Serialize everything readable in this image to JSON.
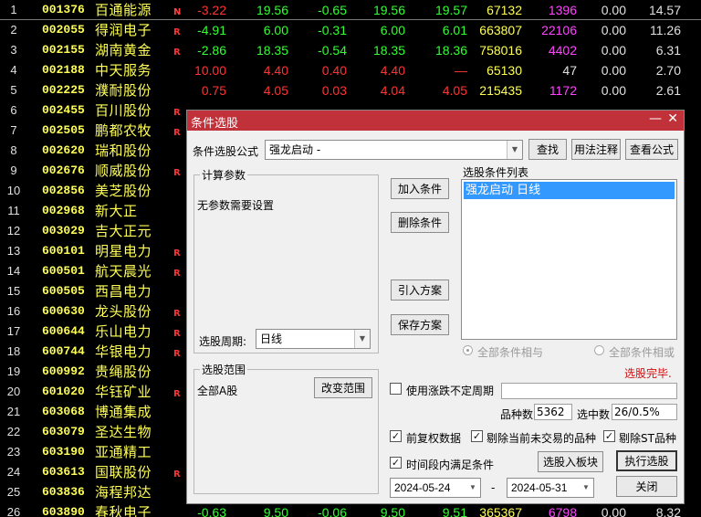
{
  "stocks": [
    {
      "idx": "1",
      "code": "001376",
      "name": "百通能源",
      "flag": "N",
      "chg": "-3.22",
      "price": "19.56",
      "amt": "-0.65",
      "open": "19.56",
      "high": "19.57",
      "vol": "67132",
      "cur": "1396",
      "x1": "0.00",
      "x2": "14.57",
      "c": [
        "r",
        "g",
        "g",
        "g",
        "g",
        "y",
        "m",
        "w",
        "w"
      ]
    },
    {
      "idx": "2",
      "code": "002055",
      "name": "得润电子",
      "flag": "R",
      "chg": "-4.91",
      "price": "6.00",
      "amt": "-0.31",
      "open": "6.00",
      "high": "6.01",
      "vol": "663807",
      "cur": "22106",
      "x1": "0.00",
      "x2": "11.26",
      "c": [
        "g",
        "g",
        "g",
        "g",
        "g",
        "y",
        "m",
        "w",
        "w"
      ]
    },
    {
      "idx": "3",
      "code": "002155",
      "name": "湖南黄金",
      "flag": "R",
      "chg": "-2.86",
      "price": "18.35",
      "amt": "-0.54",
      "open": "18.35",
      "high": "18.36",
      "vol": "758016",
      "cur": "4402",
      "x1": "0.00",
      "x2": "6.31",
      "c": [
        "g",
        "g",
        "g",
        "g",
        "g",
        "y",
        "m",
        "w",
        "w"
      ]
    },
    {
      "idx": "4",
      "code": "002188",
      "name": "中天服务",
      "flag": "",
      "chg": "10.00",
      "price": "4.40",
      "amt": "0.40",
      "open": "4.40",
      "high": "—",
      "vol": "65130",
      "cur": "47",
      "x1": "0.00",
      "x2": "2.70",
      "c": [
        "r",
        "r",
        "r",
        "r",
        "r",
        "y",
        "w",
        "w",
        "w"
      ]
    },
    {
      "idx": "5",
      "code": "002225",
      "name": "濮耐股份",
      "flag": "",
      "chg": "0.75",
      "price": "4.05",
      "amt": "0.03",
      "open": "4.04",
      "high": "4.05",
      "vol": "215435",
      "cur": "1172",
      "x1": "0.00",
      "x2": "2.61",
      "c": [
        "r",
        "r",
        "r",
        "r",
        "r",
        "y",
        "m",
        "w",
        "w"
      ]
    },
    {
      "idx": "6",
      "code": "002455",
      "name": "百川股份",
      "flag": "R",
      "chg": "",
      "price": "",
      "amt": "",
      "open": "",
      "high": "",
      "vol": "",
      "cur": "",
      "x1": "",
      "x2": "",
      "c": [
        "r",
        "r",
        "r",
        "r",
        "r",
        "y",
        "m",
        "w",
        "w"
      ]
    },
    {
      "idx": "7",
      "code": "002505",
      "name": "鹏都农牧",
      "flag": "R",
      "chg": "",
      "price": "",
      "amt": "",
      "open": "",
      "high": "",
      "vol": "",
      "cur": "",
      "x1": "",
      "x2": "",
      "c": [
        "r",
        "r",
        "r",
        "r",
        "r",
        "y",
        "m",
        "w",
        "w"
      ]
    },
    {
      "idx": "8",
      "code": "002620",
      "name": "瑞和股份",
      "flag": "",
      "chg": "",
      "price": "",
      "amt": "",
      "open": "",
      "high": "",
      "vol": "",
      "cur": "",
      "x1": "",
      "x2": "",
      "c": [
        "r",
        "r",
        "r",
        "r",
        "r",
        "y",
        "m",
        "w",
        "w"
      ]
    },
    {
      "idx": "9",
      "code": "002676",
      "name": "顺威股份",
      "flag": "R",
      "chg": "",
      "price": "",
      "amt": "",
      "open": "",
      "high": "",
      "vol": "",
      "cur": "",
      "x1": "",
      "x2": "",
      "c": [
        "r",
        "r",
        "r",
        "r",
        "r",
        "y",
        "m",
        "w",
        "w"
      ]
    },
    {
      "idx": "10",
      "code": "002856",
      "name": "美芝股份",
      "flag": "",
      "chg": "",
      "price": "",
      "amt": "",
      "open": "",
      "high": "",
      "vol": "",
      "cur": "",
      "x1": "",
      "x2": "",
      "c": [
        "r",
        "r",
        "r",
        "r",
        "r",
        "y",
        "m",
        "w",
        "w"
      ]
    },
    {
      "idx": "11",
      "code": "002968",
      "name": "新大正",
      "flag": "",
      "chg": "",
      "price": "",
      "amt": "",
      "open": "",
      "high": "",
      "vol": "",
      "cur": "",
      "x1": "",
      "x2": "",
      "c": [
        "r",
        "r",
        "r",
        "r",
        "r",
        "y",
        "m",
        "w",
        "w"
      ]
    },
    {
      "idx": "12",
      "code": "003029",
      "name": "吉大正元",
      "flag": "",
      "chg": "",
      "price": "",
      "amt": "",
      "open": "",
      "high": "",
      "vol": "",
      "cur": "",
      "x1": "",
      "x2": "",
      "c": [
        "r",
        "r",
        "r",
        "r",
        "r",
        "y",
        "m",
        "w",
        "w"
      ]
    },
    {
      "idx": "13",
      "code": "600101",
      "name": "明星电力",
      "flag": "R",
      "chg": "",
      "price": "",
      "amt": "",
      "open": "",
      "high": "",
      "vol": "",
      "cur": "",
      "x1": "",
      "x2": "",
      "c": [
        "r",
        "r",
        "r",
        "r",
        "r",
        "y",
        "m",
        "w",
        "w"
      ]
    },
    {
      "idx": "14",
      "code": "600501",
      "name": "航天晨光",
      "flag": "R",
      "chg": "",
      "price": "",
      "amt": "",
      "open": "",
      "high": "",
      "vol": "",
      "cur": "",
      "x1": "",
      "x2": "",
      "c": [
        "r",
        "r",
        "r",
        "r",
        "r",
        "y",
        "m",
        "w",
        "w"
      ]
    },
    {
      "idx": "15",
      "code": "600505",
      "name": "西昌电力",
      "flag": "",
      "chg": "",
      "price": "",
      "amt": "",
      "open": "",
      "high": "",
      "vol": "",
      "cur": "",
      "x1": "",
      "x2": "",
      "c": [
        "r",
        "r",
        "r",
        "r",
        "r",
        "y",
        "m",
        "w",
        "w"
      ]
    },
    {
      "idx": "16",
      "code": "600630",
      "name": "龙头股份",
      "flag": "R",
      "chg": "",
      "price": "",
      "amt": "",
      "open": "",
      "high": "",
      "vol": "",
      "cur": "",
      "x1": "",
      "x2": "",
      "c": [
        "r",
        "r",
        "r",
        "r",
        "r",
        "y",
        "m",
        "w",
        "w"
      ]
    },
    {
      "idx": "17",
      "code": "600644",
      "name": "乐山电力",
      "flag": "R",
      "chg": "",
      "price": "",
      "amt": "",
      "open": "",
      "high": "",
      "vol": "",
      "cur": "",
      "x1": "",
      "x2": "",
      "c": [
        "r",
        "r",
        "r",
        "r",
        "r",
        "y",
        "m",
        "w",
        "w"
      ]
    },
    {
      "idx": "18",
      "code": "600744",
      "name": "华银电力",
      "flag": "R",
      "chg": "",
      "price": "",
      "amt": "",
      "open": "",
      "high": "",
      "vol": "",
      "cur": "",
      "x1": "",
      "x2": "",
      "c": [
        "r",
        "r",
        "r",
        "r",
        "r",
        "y",
        "m",
        "w",
        "w"
      ]
    },
    {
      "idx": "19",
      "code": "600992",
      "name": "贵绳股份",
      "flag": "",
      "chg": "",
      "price": "",
      "amt": "",
      "open": "",
      "high": "",
      "vol": "",
      "cur": "",
      "x1": "",
      "x2": "",
      "c": [
        "r",
        "r",
        "r",
        "r",
        "r",
        "y",
        "m",
        "w",
        "w"
      ]
    },
    {
      "idx": "20",
      "code": "601020",
      "name": "华钰矿业",
      "flag": "R",
      "chg": "",
      "price": "",
      "amt": "",
      "open": "",
      "high": "",
      "vol": "",
      "cur": "",
      "x1": "",
      "x2": "",
      "c": [
        "r",
        "r",
        "r",
        "r",
        "r",
        "y",
        "m",
        "w",
        "w"
      ]
    },
    {
      "idx": "21",
      "code": "603068",
      "name": "博通集成",
      "flag": "",
      "chg": "",
      "price": "",
      "amt": "",
      "open": "",
      "high": "",
      "vol": "",
      "cur": "",
      "x1": "",
      "x2": "",
      "c": [
        "r",
        "r",
        "r",
        "r",
        "r",
        "y",
        "m",
        "w",
        "w"
      ]
    },
    {
      "idx": "22",
      "code": "603079",
      "name": "圣达生物",
      "flag": "",
      "chg": "",
      "price": "",
      "amt": "",
      "open": "",
      "high": "",
      "vol": "",
      "cur": "",
      "x1": "",
      "x2": "",
      "c": [
        "r",
        "r",
        "r",
        "r",
        "r",
        "y",
        "m",
        "w",
        "w"
      ]
    },
    {
      "idx": "23",
      "code": "603190",
      "name": "亚通精工",
      "flag": "",
      "chg": "",
      "price": "",
      "amt": "",
      "open": "",
      "high": "",
      "vol": "",
      "cur": "",
      "x1": "",
      "x2": "",
      "c": [
        "r",
        "r",
        "r",
        "r",
        "r",
        "y",
        "m",
        "w",
        "w"
      ]
    },
    {
      "idx": "24",
      "code": "603613",
      "name": "国联股份",
      "flag": "R",
      "chg": "",
      "price": "",
      "amt": "",
      "open": "",
      "high": "",
      "vol": "",
      "cur": "",
      "x1": "",
      "x2": "",
      "c": [
        "r",
        "r",
        "r",
        "r",
        "r",
        "y",
        "m",
        "w",
        "w"
      ]
    },
    {
      "idx": "25",
      "code": "603836",
      "name": "海程邦达",
      "flag": "",
      "chg": "",
      "price": "",
      "amt": "",
      "open": "",
      "high": "",
      "vol": "",
      "cur": "",
      "x1": "",
      "x2": "",
      "c": [
        "r",
        "r",
        "r",
        "r",
        "r",
        "y",
        "m",
        "w",
        "w"
      ]
    },
    {
      "idx": "26",
      "code": "603890",
      "name": "春秋电子",
      "flag": "",
      "chg": "-0.63",
      "price": "9.50",
      "amt": "-0.06",
      "open": "9.50",
      "high": "9.51",
      "vol": "365367",
      "cur": "6798",
      "x1": "0.00",
      "x2": "8.32",
      "c": [
        "g",
        "g",
        "g",
        "g",
        "g",
        "y",
        "m",
        "w",
        "w"
      ]
    }
  ],
  "dialog": {
    "title": "条件选股",
    "minimize": "—",
    "close": "✕",
    "formula_label": "条件选股公式",
    "formula_value": "强龙启动     -",
    "search_btn": "查找",
    "usage_btn": "用法注释",
    "view_formula_btn": "查看公式",
    "calc_params_caption": "计算参数",
    "no_params_text": "无参数需要设置",
    "period_label": "选股周期:",
    "period_value": "日线",
    "add_condition_btn": "加入条件",
    "delete_condition_btn": "删除条件",
    "import_plan_btn": "引入方案",
    "save_plan_btn": "保存方案",
    "condition_list_label": "选股条件列表",
    "condition_item": "强龙启动  日线",
    "radio_and": "全部条件相与",
    "radio_or": "全部条件相或",
    "status": "选股完毕.",
    "scope_caption": "选股范围",
    "scope_value": "全部A股",
    "change_scope_btn": "改变范围",
    "use_period_label": "使用涨跌不定周期",
    "species_label": "品种数",
    "species_count": "5362",
    "selected_label": "选中数",
    "selected_value": "26/0.5%",
    "adjust_label": "前复权数据",
    "exclude_untraded_label": "剔除当前未交易的品种",
    "exclude_st_label": "剔除ST品种",
    "time_range_label": "时间段内满足条件",
    "add_to_block_btn": "选股入板块",
    "execute_btn": "执行选股",
    "date_from": "2024-05-24",
    "date_sep": "-",
    "date_to": "2024-05-31",
    "close_btn": "关闭",
    "check_mark": "✓",
    "dropdown_icon": "▼"
  },
  "colors": {
    "titlebar": "#c0313a",
    "up": "#ff3333",
    "down": "#33ff33",
    "code": "#ffff55",
    "volume_magenta": "#ff44ff",
    "selection_blue": "#3399ff",
    "status_red": "#d01010"
  }
}
